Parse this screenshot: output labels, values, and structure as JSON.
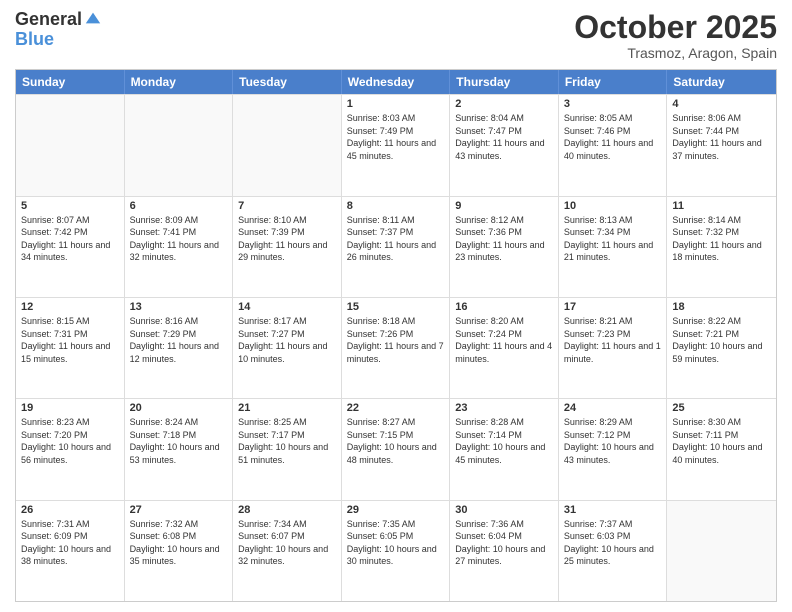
{
  "logo": {
    "general": "General",
    "blue": "Blue"
  },
  "header": {
    "month": "October 2025",
    "location": "Trasmoz, Aragon, Spain"
  },
  "weekdays": [
    "Sunday",
    "Monday",
    "Tuesday",
    "Wednesday",
    "Thursday",
    "Friday",
    "Saturday"
  ],
  "rows": [
    [
      {
        "day": "",
        "text": ""
      },
      {
        "day": "",
        "text": ""
      },
      {
        "day": "",
        "text": ""
      },
      {
        "day": "1",
        "text": "Sunrise: 8:03 AM\nSunset: 7:49 PM\nDaylight: 11 hours and 45 minutes."
      },
      {
        "day": "2",
        "text": "Sunrise: 8:04 AM\nSunset: 7:47 PM\nDaylight: 11 hours and 43 minutes."
      },
      {
        "day": "3",
        "text": "Sunrise: 8:05 AM\nSunset: 7:46 PM\nDaylight: 11 hours and 40 minutes."
      },
      {
        "day": "4",
        "text": "Sunrise: 8:06 AM\nSunset: 7:44 PM\nDaylight: 11 hours and 37 minutes."
      }
    ],
    [
      {
        "day": "5",
        "text": "Sunrise: 8:07 AM\nSunset: 7:42 PM\nDaylight: 11 hours and 34 minutes."
      },
      {
        "day": "6",
        "text": "Sunrise: 8:09 AM\nSunset: 7:41 PM\nDaylight: 11 hours and 32 minutes."
      },
      {
        "day": "7",
        "text": "Sunrise: 8:10 AM\nSunset: 7:39 PM\nDaylight: 11 hours and 29 minutes."
      },
      {
        "day": "8",
        "text": "Sunrise: 8:11 AM\nSunset: 7:37 PM\nDaylight: 11 hours and 26 minutes."
      },
      {
        "day": "9",
        "text": "Sunrise: 8:12 AM\nSunset: 7:36 PM\nDaylight: 11 hours and 23 minutes."
      },
      {
        "day": "10",
        "text": "Sunrise: 8:13 AM\nSunset: 7:34 PM\nDaylight: 11 hours and 21 minutes."
      },
      {
        "day": "11",
        "text": "Sunrise: 8:14 AM\nSunset: 7:32 PM\nDaylight: 11 hours and 18 minutes."
      }
    ],
    [
      {
        "day": "12",
        "text": "Sunrise: 8:15 AM\nSunset: 7:31 PM\nDaylight: 11 hours and 15 minutes."
      },
      {
        "day": "13",
        "text": "Sunrise: 8:16 AM\nSunset: 7:29 PM\nDaylight: 11 hours and 12 minutes."
      },
      {
        "day": "14",
        "text": "Sunrise: 8:17 AM\nSunset: 7:27 PM\nDaylight: 11 hours and 10 minutes."
      },
      {
        "day": "15",
        "text": "Sunrise: 8:18 AM\nSunset: 7:26 PM\nDaylight: 11 hours and 7 minutes."
      },
      {
        "day": "16",
        "text": "Sunrise: 8:20 AM\nSunset: 7:24 PM\nDaylight: 11 hours and 4 minutes."
      },
      {
        "day": "17",
        "text": "Sunrise: 8:21 AM\nSunset: 7:23 PM\nDaylight: 11 hours and 1 minute."
      },
      {
        "day": "18",
        "text": "Sunrise: 8:22 AM\nSunset: 7:21 PM\nDaylight: 10 hours and 59 minutes."
      }
    ],
    [
      {
        "day": "19",
        "text": "Sunrise: 8:23 AM\nSunset: 7:20 PM\nDaylight: 10 hours and 56 minutes."
      },
      {
        "day": "20",
        "text": "Sunrise: 8:24 AM\nSunset: 7:18 PM\nDaylight: 10 hours and 53 minutes."
      },
      {
        "day": "21",
        "text": "Sunrise: 8:25 AM\nSunset: 7:17 PM\nDaylight: 10 hours and 51 minutes."
      },
      {
        "day": "22",
        "text": "Sunrise: 8:27 AM\nSunset: 7:15 PM\nDaylight: 10 hours and 48 minutes."
      },
      {
        "day": "23",
        "text": "Sunrise: 8:28 AM\nSunset: 7:14 PM\nDaylight: 10 hours and 45 minutes."
      },
      {
        "day": "24",
        "text": "Sunrise: 8:29 AM\nSunset: 7:12 PM\nDaylight: 10 hours and 43 minutes."
      },
      {
        "day": "25",
        "text": "Sunrise: 8:30 AM\nSunset: 7:11 PM\nDaylight: 10 hours and 40 minutes."
      }
    ],
    [
      {
        "day": "26",
        "text": "Sunrise: 7:31 AM\nSunset: 6:09 PM\nDaylight: 10 hours and 38 minutes."
      },
      {
        "day": "27",
        "text": "Sunrise: 7:32 AM\nSunset: 6:08 PM\nDaylight: 10 hours and 35 minutes."
      },
      {
        "day": "28",
        "text": "Sunrise: 7:34 AM\nSunset: 6:07 PM\nDaylight: 10 hours and 32 minutes."
      },
      {
        "day": "29",
        "text": "Sunrise: 7:35 AM\nSunset: 6:05 PM\nDaylight: 10 hours and 30 minutes."
      },
      {
        "day": "30",
        "text": "Sunrise: 7:36 AM\nSunset: 6:04 PM\nDaylight: 10 hours and 27 minutes."
      },
      {
        "day": "31",
        "text": "Sunrise: 7:37 AM\nSunset: 6:03 PM\nDaylight: 10 hours and 25 minutes."
      },
      {
        "day": "",
        "text": ""
      }
    ]
  ]
}
